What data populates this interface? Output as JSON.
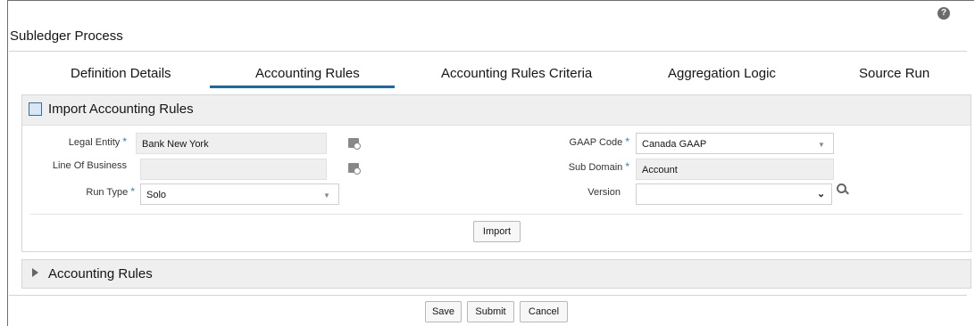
{
  "header": {
    "title": "Subledger Process",
    "help_icon": "question-circle-icon",
    "help_glyph": "?"
  },
  "tabs": [
    {
      "label": "Definition Details"
    },
    {
      "label": "Accounting Rules",
      "active": true
    },
    {
      "label": "Accounting Rules Criteria"
    },
    {
      "label": "Aggregation Logic"
    },
    {
      "label": "Source Run"
    }
  ],
  "import_section": {
    "title": "Import Accounting Rules",
    "icon": "import-icon",
    "legal_entity": {
      "label": "Legal Entity",
      "value": "Bank New York",
      "required": true
    },
    "line_of_business": {
      "label": "Line Of Business",
      "value": ""
    },
    "run_type": {
      "label": "Run Type",
      "value": "Solo",
      "required": true
    },
    "gaap_code": {
      "label": "GAAP Code",
      "value": "Canada GAAP",
      "required": true
    },
    "sub_domain": {
      "label": "Sub Domain",
      "value": "Account",
      "required": true
    },
    "version": {
      "label": "Version",
      "value": ""
    },
    "required_marker": "*",
    "import_button": "Import"
  },
  "rules_section": {
    "title": "Accounting Rules",
    "collapsed": true
  },
  "footer": {
    "save": "Save",
    "submit": "Submit",
    "cancel": "Cancel"
  },
  "colors": {
    "accent": "#1a6aa6",
    "panel_bg": "#efefef",
    "required": "#2f7fc1"
  }
}
